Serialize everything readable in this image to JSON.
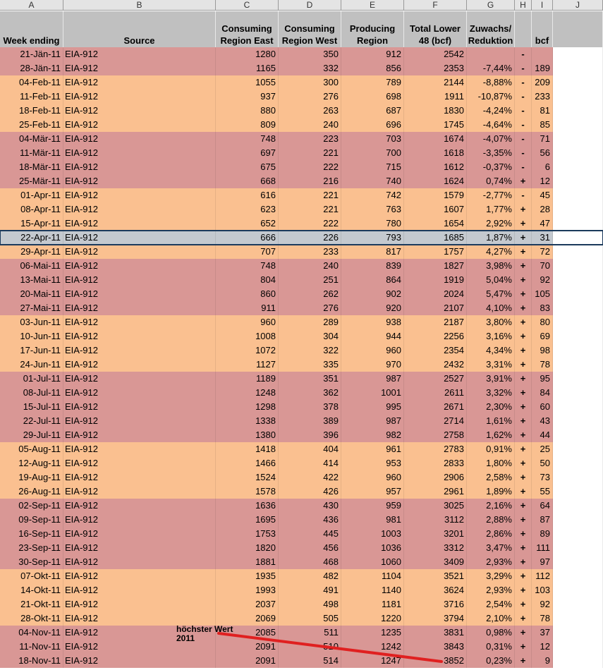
{
  "column_letters": [
    "A",
    "B",
    "C",
    "D",
    "E",
    "F",
    "G",
    "H",
    "I",
    "J"
  ],
  "headers": {
    "week_ending": "Week ending",
    "source": "Source",
    "cons_east": "Consuming Region East",
    "cons_west": "Consuming Region West",
    "producing": "Producing Region",
    "total": "Total Lower 48 (bcf)",
    "zuwachs": "Zuwachs/ Reduktion",
    "sign": "",
    "bcf": "bcf",
    "j": ""
  },
  "band_colors": {
    "pink": "#d99795",
    "orange": "#fac090",
    "header": "#c0c0c0"
  },
  "rows": [
    {
      "week": "21-Jän-11",
      "source": "EIA-912",
      "east": "1280",
      "west": "350",
      "prod": "912",
      "total": "2542",
      "pct": "",
      "sign": "-",
      "bcf": "",
      "band": "pink"
    },
    {
      "week": "28-Jän-11",
      "source": "EIA-912",
      "east": "1165",
      "west": "332",
      "prod": "856",
      "total": "2353",
      "pct": "-7,44%",
      "sign": "-",
      "bcf": "189",
      "band": "pink"
    },
    {
      "week": "04-Feb-11",
      "source": "EIA-912",
      "east": "1055",
      "west": "300",
      "prod": "789",
      "total": "2144",
      "pct": "-8,88%",
      "sign": "-",
      "bcf": "209",
      "band": "orange"
    },
    {
      "week": "11-Feb-11",
      "source": "EIA-912",
      "east": "937",
      "west": "276",
      "prod": "698",
      "total": "1911",
      "pct": "-10,87%",
      "sign": "-",
      "bcf": "233",
      "band": "orange"
    },
    {
      "week": "18-Feb-11",
      "source": "EIA-912",
      "east": "880",
      "west": "263",
      "prod": "687",
      "total": "1830",
      "pct": "-4,24%",
      "sign": "-",
      "bcf": "81",
      "band": "orange"
    },
    {
      "week": "25-Feb-11",
      "source": "EIA-912",
      "east": "809",
      "west": "240",
      "prod": "696",
      "total": "1745",
      "pct": "-4,64%",
      "sign": "-",
      "bcf": "85",
      "band": "orange"
    },
    {
      "week": "04-Mär-11",
      "source": "EIA-912",
      "east": "748",
      "west": "223",
      "prod": "703",
      "total": "1674",
      "pct": "-4,07%",
      "sign": "-",
      "bcf": "71",
      "band": "pink"
    },
    {
      "week": "11-Mär-11",
      "source": "EIA-912",
      "east": "697",
      "west": "221",
      "prod": "700",
      "total": "1618",
      "pct": "-3,35%",
      "sign": "-",
      "bcf": "56",
      "band": "pink"
    },
    {
      "week": "18-Mär-11",
      "source": "EIA-912",
      "east": "675",
      "west": "222",
      "prod": "715",
      "total": "1612",
      "pct": "-0,37%",
      "sign": "-",
      "bcf": "6",
      "band": "pink"
    },
    {
      "week": "25-Mär-11",
      "source": "EIA-912",
      "east": "668",
      "west": "216",
      "prod": "740",
      "total": "1624",
      "pct": "0,74%",
      "sign": "+",
      "bcf": "12",
      "band": "pink"
    },
    {
      "week": "01-Apr-11",
      "source": "EIA-912",
      "east": "616",
      "west": "221",
      "prod": "742",
      "total": "1579",
      "pct": "-2,77%",
      "sign": "-",
      "bcf": "45",
      "band": "orange"
    },
    {
      "week": "08-Apr-11",
      "source": "EIA-912",
      "east": "623",
      "west": "221",
      "prod": "763",
      "total": "1607",
      "pct": "1,77%",
      "sign": "+",
      "bcf": "28",
      "band": "orange"
    },
    {
      "week": "15-Apr-11",
      "source": "EIA-912",
      "east": "652",
      "west": "222",
      "prod": "780",
      "total": "1654",
      "pct": "2,92%",
      "sign": "+",
      "bcf": "47",
      "band": "orange"
    },
    {
      "week": "22-Apr-11",
      "source": "EIA-912",
      "east": "666",
      "west": "226",
      "prod": "793",
      "total": "1685",
      "pct": "1,87%",
      "sign": "+",
      "bcf": "31",
      "band": "orange",
      "selected": true
    },
    {
      "week": "29-Apr-11",
      "source": "EIA-912",
      "east": "707",
      "west": "233",
      "prod": "817",
      "total": "1757",
      "pct": "4,27%",
      "sign": "+",
      "bcf": "72",
      "band": "orange"
    },
    {
      "week": "06-Mai-11",
      "source": "EIA-912",
      "east": "748",
      "west": "240",
      "prod": "839",
      "total": "1827",
      "pct": "3,98%",
      "sign": "+",
      "bcf": "70",
      "band": "pink"
    },
    {
      "week": "13-Mai-11",
      "source": "EIA-912",
      "east": "804",
      "west": "251",
      "prod": "864",
      "total": "1919",
      "pct": "5,04%",
      "sign": "+",
      "bcf": "92",
      "band": "pink"
    },
    {
      "week": "20-Mai-11",
      "source": "EIA-912",
      "east": "860",
      "west": "262",
      "prod": "902",
      "total": "2024",
      "pct": "5,47%",
      "sign": "+",
      "bcf": "105",
      "band": "pink"
    },
    {
      "week": "27-Mai-11",
      "source": "EIA-912",
      "east": "911",
      "west": "276",
      "prod": "920",
      "total": "2107",
      "pct": "4,10%",
      "sign": "+",
      "bcf": "83",
      "band": "pink"
    },
    {
      "week": "03-Jun-11",
      "source": "EIA-912",
      "east": "960",
      "west": "289",
      "prod": "938",
      "total": "2187",
      "pct": "3,80%",
      "sign": "+",
      "bcf": "80",
      "band": "orange"
    },
    {
      "week": "10-Jun-11",
      "source": "EIA-912",
      "east": "1008",
      "west": "304",
      "prod": "944",
      "total": "2256",
      "pct": "3,16%",
      "sign": "+",
      "bcf": "69",
      "band": "orange"
    },
    {
      "week": "17-Jun-11",
      "source": "EIA-912",
      "east": "1072",
      "west": "322",
      "prod": "960",
      "total": "2354",
      "pct": "4,34%",
      "sign": "+",
      "bcf": "98",
      "band": "orange"
    },
    {
      "week": "24-Jun-11",
      "source": "EIA-912",
      "east": "1127",
      "west": "335",
      "prod": "970",
      "total": "2432",
      "pct": "3,31%",
      "sign": "+",
      "bcf": "78",
      "band": "orange"
    },
    {
      "week": "01-Jul-11",
      "source": "EIA-912",
      "east": "1189",
      "west": "351",
      "prod": "987",
      "total": "2527",
      "pct": "3,91%",
      "sign": "+",
      "bcf": "95",
      "band": "pink"
    },
    {
      "week": "08-Jul-11",
      "source": "EIA-912",
      "east": "1248",
      "west": "362",
      "prod": "1001",
      "total": "2611",
      "pct": "3,32%",
      "sign": "+",
      "bcf": "84",
      "band": "pink"
    },
    {
      "week": "15-Jul-11",
      "source": "EIA-912",
      "east": "1298",
      "west": "378",
      "prod": "995",
      "total": "2671",
      "pct": "2,30%",
      "sign": "+",
      "bcf": "60",
      "band": "pink"
    },
    {
      "week": "22-Jul-11",
      "source": "EIA-912",
      "east": "1338",
      "west": "389",
      "prod": "987",
      "total": "2714",
      "pct": "1,61%",
      "sign": "+",
      "bcf": "43",
      "band": "pink"
    },
    {
      "week": "29-Jul-11",
      "source": "EIA-912",
      "east": "1380",
      "west": "396",
      "prod": "982",
      "total": "2758",
      "pct": "1,62%",
      "sign": "+",
      "bcf": "44",
      "band": "pink"
    },
    {
      "week": "05-Aug-11",
      "source": "EIA-912",
      "east": "1418",
      "west": "404",
      "prod": "961",
      "total": "2783",
      "pct": "0,91%",
      "sign": "+",
      "bcf": "25",
      "band": "orange"
    },
    {
      "week": "12-Aug-11",
      "source": "EIA-912",
      "east": "1466",
      "west": "414",
      "prod": "953",
      "total": "2833",
      "pct": "1,80%",
      "sign": "+",
      "bcf": "50",
      "band": "orange"
    },
    {
      "week": "19-Aug-11",
      "source": "EIA-912",
      "east": "1524",
      "west": "422",
      "prod": "960",
      "total": "2906",
      "pct": "2,58%",
      "sign": "+",
      "bcf": "73",
      "band": "orange"
    },
    {
      "week": "26-Aug-11",
      "source": "EIA-912",
      "east": "1578",
      "west": "426",
      "prod": "957",
      "total": "2961",
      "pct": "1,89%",
      "sign": "+",
      "bcf": "55",
      "band": "orange"
    },
    {
      "week": "02-Sep-11",
      "source": "EIA-912",
      "east": "1636",
      "west": "430",
      "prod": "959",
      "total": "3025",
      "pct": "2,16%",
      "sign": "+",
      "bcf": "64",
      "band": "pink"
    },
    {
      "week": "09-Sep-11",
      "source": "EIA-912",
      "east": "1695",
      "west": "436",
      "prod": "981",
      "total": "3112",
      "pct": "2,88%",
      "sign": "+",
      "bcf": "87",
      "band": "pink"
    },
    {
      "week": "16-Sep-11",
      "source": "EIA-912",
      "east": "1753",
      "west": "445",
      "prod": "1003",
      "total": "3201",
      "pct": "2,86%",
      "sign": "+",
      "bcf": "89",
      "band": "pink"
    },
    {
      "week": "23-Sep-11",
      "source": "EIA-912",
      "east": "1820",
      "west": "456",
      "prod": "1036",
      "total": "3312",
      "pct": "3,47%",
      "sign": "+",
      "bcf": "111",
      "band": "pink"
    },
    {
      "week": "30-Sep-11",
      "source": "EIA-912",
      "east": "1881",
      "west": "468",
      "prod": "1060",
      "total": "3409",
      "pct": "2,93%",
      "sign": "+",
      "bcf": "97",
      "band": "pink"
    },
    {
      "week": "07-Okt-11",
      "source": "EIA-912",
      "east": "1935",
      "west": "482",
      "prod": "1104",
      "total": "3521",
      "pct": "3,29%",
      "sign": "+",
      "bcf": "112",
      "band": "orange"
    },
    {
      "week": "14-Okt-11",
      "source": "EIA-912",
      "east": "1993",
      "west": "491",
      "prod": "1140",
      "total": "3624",
      "pct": "2,93%",
      "sign": "+",
      "bcf": "103",
      "band": "orange"
    },
    {
      "week": "21-Okt-11",
      "source": "EIA-912",
      "east": "2037",
      "west": "498",
      "prod": "1181",
      "total": "3716",
      "pct": "2,54%",
      "sign": "+",
      "bcf": "92",
      "band": "orange"
    },
    {
      "week": "28-Okt-11",
      "source": "EIA-912",
      "east": "2069",
      "west": "505",
      "prod": "1220",
      "total": "3794",
      "pct": "2,10%",
      "sign": "+",
      "bcf": "78",
      "band": "orange"
    },
    {
      "week": "04-Nov-11",
      "source": "EIA-912",
      "east": "2085",
      "west": "511",
      "prod": "1235",
      "total": "3831",
      "pct": "0,98%",
      "sign": "+",
      "bcf": "37",
      "band": "pink"
    },
    {
      "week": "11-Nov-11",
      "source": "EIA-912",
      "east": "2091",
      "west": "510",
      "prod": "1242",
      "total": "3843",
      "pct": "0,31%",
      "sign": "+",
      "bcf": "12",
      "band": "pink"
    },
    {
      "week": "18-Nov-11",
      "source": "EIA-912",
      "east": "2091",
      "west": "514",
      "prod": "1247",
      "total": "3852",
      "pct": "0,23%",
      "sign": "+",
      "bcf": "9",
      "band": "pink"
    }
  ],
  "annotation": {
    "line1": "höchster Wert",
    "line2": "2011",
    "color": "#e02020"
  }
}
